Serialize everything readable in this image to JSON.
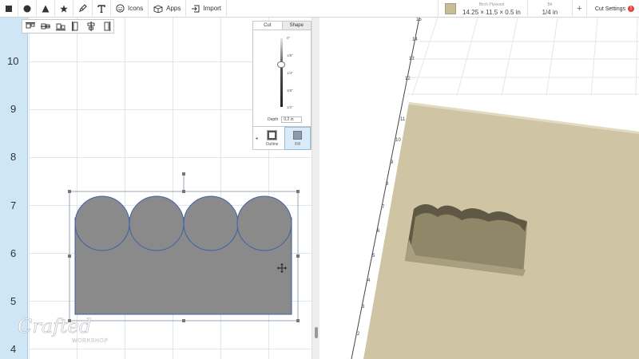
{
  "toolbar": {
    "tools": [
      {
        "id": "square",
        "icon": "square-icon"
      },
      {
        "id": "circle",
        "icon": "circle-icon"
      },
      {
        "id": "triangle",
        "icon": "triangle-icon"
      },
      {
        "id": "star",
        "icon": "star-icon"
      },
      {
        "id": "pen",
        "icon": "pen-icon"
      },
      {
        "id": "text",
        "icon": "text-icon"
      }
    ],
    "icons_label": "Icons",
    "apps_label": "Apps",
    "import_label": "Import"
  },
  "material": {
    "name": "Birch Plywood",
    "dimensions": "14.25 × 11.5 × 0.5 in",
    "swatch_color": "#c7bd97"
  },
  "bit": {
    "label": "Bit",
    "value": "1/4 in"
  },
  "add_label": "+",
  "cut_settings": {
    "label": "Cut Settings",
    "badge": "!"
  },
  "design": {
    "ruler_labels": [
      "10",
      "9",
      "8",
      "7",
      "6",
      "5",
      "4"
    ],
    "shape_fill": "#8a8a8a",
    "shape_stroke": "#3f5fa8"
  },
  "cut_panel": {
    "tabs": [
      "Cut",
      "Shape"
    ],
    "active_tab": "Cut",
    "depth_marks": [
      "0\"",
      "1/8\"",
      "1/4\"",
      "3/8\"",
      "1/2\""
    ],
    "depth_label": "Depth",
    "depth_value": "0.2 in",
    "modes": [
      "Outline",
      "Fill"
    ],
    "active_mode": "Fill"
  },
  "preview": {
    "ruler_labels_left": [
      "15",
      "14",
      "13",
      "12",
      "11",
      "10",
      "9",
      "8",
      "7",
      "6",
      "5",
      "4",
      "3",
      "2"
    ],
    "wood_color": "#cfc5a4"
  },
  "watermark": {
    "line1": "Crafted",
    "line2": "WORKSHOP"
  }
}
